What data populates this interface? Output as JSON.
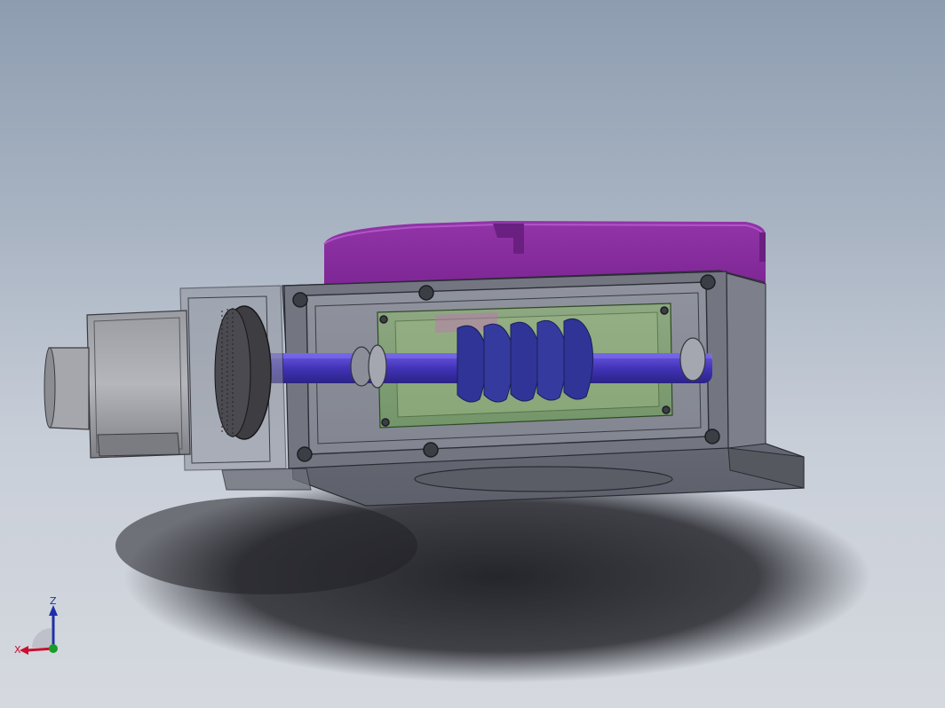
{
  "viewport": {
    "background_top": "#8d9db0",
    "background_bottom": "#d5d9df"
  },
  "model": {
    "colors": {
      "turntable": "#9b2fb0",
      "housing": "#6a6d78",
      "worm": "#2a2e8c",
      "shaft": "#4b3bc4",
      "bearing_cage": "#5d8a4a",
      "motor": "#8d8f94",
      "pulley": "#3a3a3e"
    }
  },
  "triad": {
    "x_label": "X",
    "z_label": "Z",
    "x_color": "#c8102e",
    "z_color": "#1f2fa8",
    "y_color": "#1a9a2a"
  }
}
